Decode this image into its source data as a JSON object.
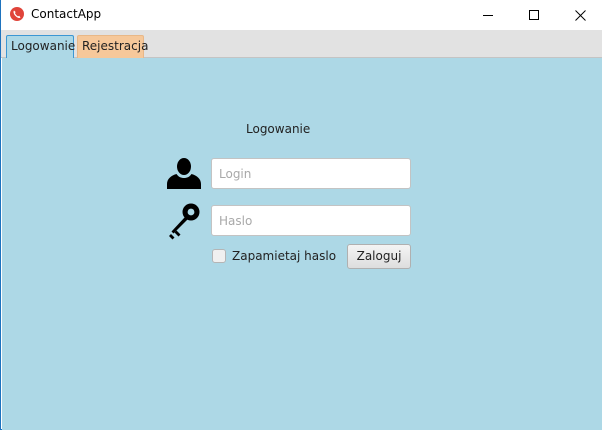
{
  "window": {
    "title": "ContactApp",
    "controls": {
      "minimize": "minimize",
      "maximize": "maximize",
      "close": "close"
    }
  },
  "tabs": [
    {
      "label": "Logowanie",
      "active": true
    },
    {
      "label": "Rejestracja",
      "active": false
    }
  ],
  "login_form": {
    "title": "Logowanie",
    "login_placeholder": "Login",
    "login_value": "",
    "password_placeholder": "Haslo",
    "password_value": "",
    "remember_label": "Zapamietaj haslo",
    "remember_checked": false,
    "submit_label": "Zaloguj"
  },
  "colors": {
    "content_background": "#add8e6",
    "inactive_tab": "#f6c89a",
    "app_icon": "#e0443a"
  },
  "icons": {
    "login": "user-icon",
    "password": "key-icon"
  }
}
